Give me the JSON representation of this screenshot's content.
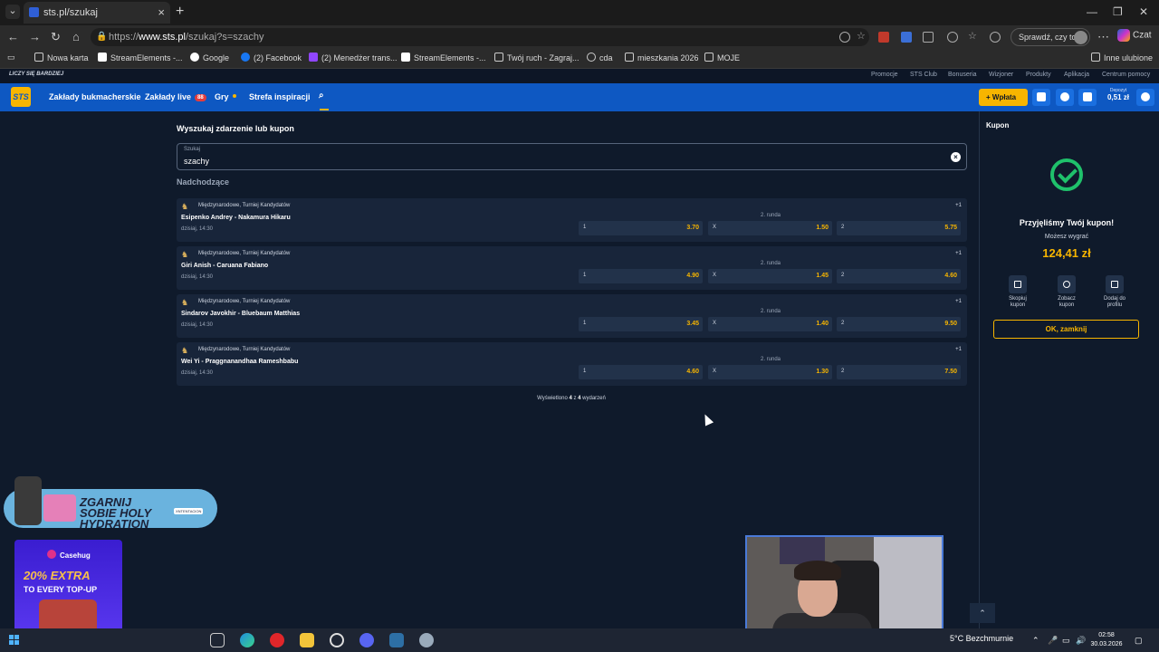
{
  "browser": {
    "tab_title": "sts.pl/szukaj",
    "url_prefix": "https://",
    "url_domain": "www.sts.pl",
    "url_path": "/szukaj?s=szachy",
    "profile_label": "Sprawdź, czy to Ty",
    "copilot_label": "Czat",
    "bookmarks": [
      "Nowa karta",
      "StreamElements -...",
      "Google",
      "(2) Facebook",
      "(2) Menedżer trans...",
      "StreamElements -...",
      "Twój ruch - Zagraj...",
      "cda",
      "mieszkania 2026",
      "MOJE"
    ],
    "other_bookmarks": "Inne ulubione"
  },
  "site": {
    "tagline": "LICZY SIĘ BARDZIEJ",
    "top_links": [
      "Promocje",
      "STS Club",
      "Bonuseria",
      "Wizjoner",
      "Produkty",
      "Aplikacja",
      "Centrum pomocy"
    ],
    "nav": {
      "sports": "Zakłady bukmacherskie",
      "live": "Zakłady live",
      "live_count": "88",
      "games": "Gry",
      "inspiration": "Strefa inspiracji"
    },
    "deposit_label": "Wpłata",
    "balance_label": "Depozyt",
    "balance_value": "0,51 zł",
    "logo": "STS"
  },
  "search": {
    "title": "Wyszukaj zdarzenie lub kupon",
    "field_label": "Szukaj",
    "value": "szachy",
    "section": "Nadchodzące"
  },
  "events": [
    {
      "league": "Międzynarodowe, Turniej Kandydatów",
      "teams": "Esipenko Andrey - Nakamura Hikaru",
      "time": "dzisiaj, 14:30",
      "more": "+1",
      "round": "2. runda",
      "odds": [
        {
          "k": "1",
          "v": "3.70"
        },
        {
          "k": "X",
          "v": "1.50"
        },
        {
          "k": "2",
          "v": "5.75"
        }
      ]
    },
    {
      "league": "Międzynarodowe, Turniej Kandydatów",
      "teams": "Giri Anish - Caruana Fabiano",
      "time": "dzisiaj, 14:30",
      "more": "+1",
      "round": "2. runda",
      "odds": [
        {
          "k": "1",
          "v": "4.90"
        },
        {
          "k": "X",
          "v": "1.45"
        },
        {
          "k": "2",
          "v": "4.60"
        }
      ]
    },
    {
      "league": "Międzynarodowe, Turniej Kandydatów",
      "teams": "Sindarov Javokhir - Bluebaum Matthias",
      "time": "dzisiaj, 14:30",
      "more": "+1",
      "round": "2. runda",
      "odds": [
        {
          "k": "1",
          "v": "3.45"
        },
        {
          "k": "X",
          "v": "1.40"
        },
        {
          "k": "2",
          "v": "9.50"
        }
      ]
    },
    {
      "league": "Międzynarodowe, Turniej Kandydatów",
      "teams": "Wei Yi - Praggnanandhaa Rameshbabu",
      "time": "dzisiaj, 14:30",
      "more": "+1",
      "round": "2. runda",
      "odds": [
        {
          "k": "1",
          "v": "4.60"
        },
        {
          "k": "X",
          "v": "1.30"
        },
        {
          "k": "2",
          "v": "7.50"
        }
      ]
    }
  ],
  "results_summary": {
    "prefix": "Wyświetlono ",
    "shown": "4",
    "middle": " z ",
    "total": "4",
    "suffix": " wydarzeń"
  },
  "coupon": {
    "title": "Kupon",
    "accepted": "Przyjęliśmy Twój kupon!",
    "can_win": "Możesz wygrać",
    "amount": "124,41 zł",
    "actions": [
      {
        "line1": "Skopiuj",
        "line2": "kupon"
      },
      {
        "line1": "Zobacz",
        "line2": "kupon"
      },
      {
        "line1": "Dodaj do",
        "line2": "profilu"
      }
    ],
    "ok_label": "OK, zamknij"
  },
  "promos": {
    "hydration": "ZGARNIJ SOBIE HOLY HYDRATION",
    "hydration_tag": "XNTENTACION",
    "casehug_brand": "Casehug",
    "casehug_extra": "20% EXTRA",
    "casehug_every": "TO EVERY TOP-UP"
  },
  "taskbar": {
    "weather": "5°C Bezchmurnie",
    "time": "02:58",
    "date": "30.03.2026"
  }
}
